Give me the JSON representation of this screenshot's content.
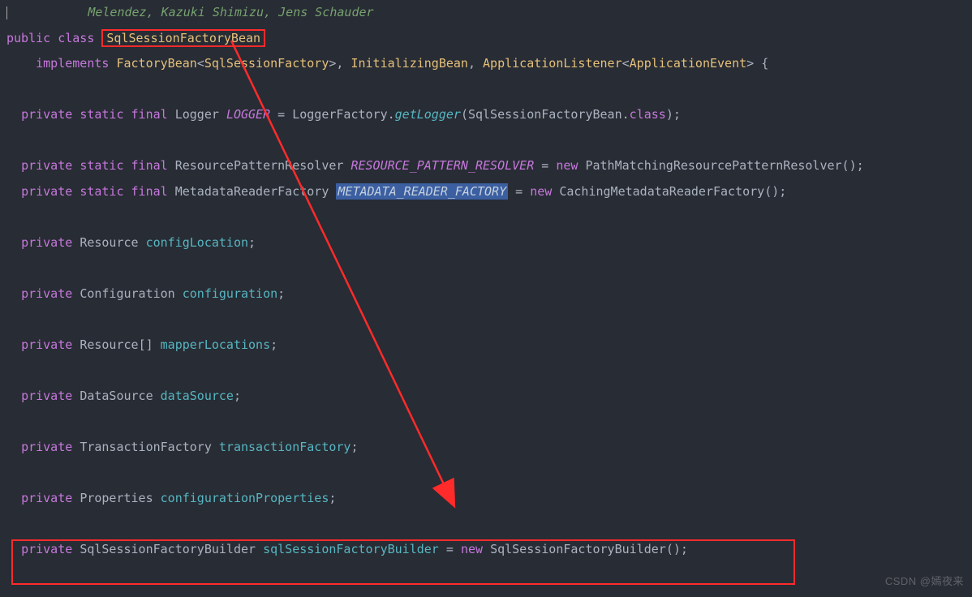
{
  "comment_authors": "Melendez, Kazuki Shimizu, Jens Schauder",
  "line_decl": {
    "public": "public",
    "class": "class",
    "name": "SqlSessionFactoryBean"
  },
  "line_impl": {
    "implements": "implements",
    "fb": "FactoryBean",
    "sfs": "SqlSessionFactory",
    "ib": "InitializingBean",
    "al": "ApplicationListener",
    "ae": "ApplicationEvent"
  },
  "logger": {
    "private": "private",
    "static": "static",
    "final": "final",
    "type": "Logger",
    "name": "LOGGER",
    "factory": "LoggerFactory",
    "method": "getLogger",
    "arg": "SqlSessionFactoryBean",
    "classkw": "class"
  },
  "rpr": {
    "type": "ResourcePatternResolver",
    "name": "RESOURCE_PATTERN_RESOLVER",
    "new": "new",
    "ctor": "PathMatchingResourcePatternResolver"
  },
  "mrf": {
    "type": "MetadataReaderFactory",
    "name": "METADATA_READER_FACTORY",
    "new": "new",
    "ctor": "CachingMetadataReaderFactory"
  },
  "fields": {
    "configLocation": {
      "type": "Resource",
      "name": "configLocation"
    },
    "configuration": {
      "type": "Configuration",
      "name": "configuration"
    },
    "mapperLocations": {
      "type": "Resource",
      "arr": "[]",
      "name": "mapperLocations"
    },
    "dataSource": {
      "type": "DataSource",
      "name": "dataSource"
    },
    "transactionFactory": {
      "type": "TransactionFactory",
      "name": "transactionFactory"
    },
    "configurationProperties": {
      "type": "Properties",
      "name": "configurationProperties"
    }
  },
  "builder": {
    "type": "SqlSessionFactoryBuilder",
    "name": "sqlSessionFactoryBuilder",
    "new": "new",
    "ctor": "SqlSessionFactoryBuilder"
  },
  "watermark": "CSDN @嫣夜来"
}
